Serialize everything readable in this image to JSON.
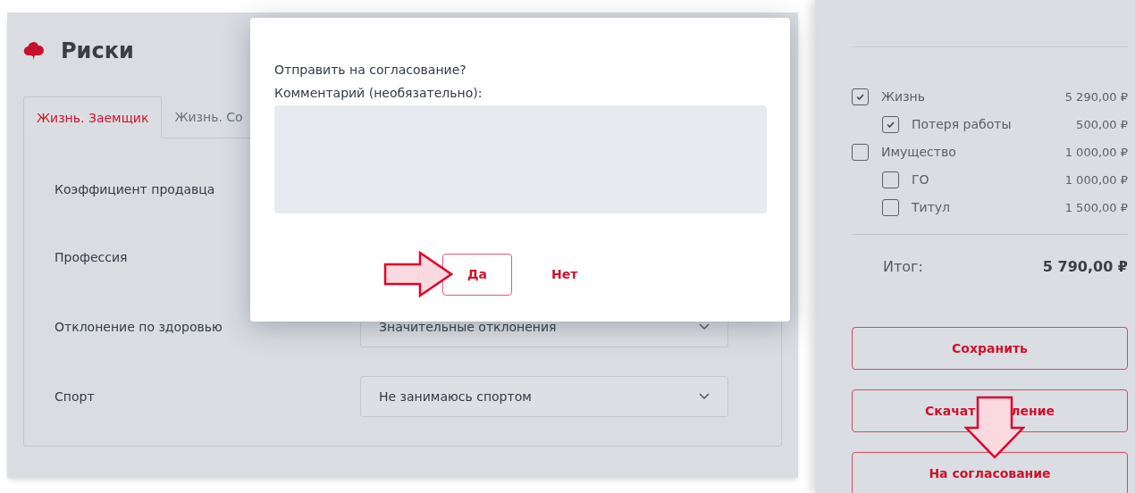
{
  "page": {
    "title": "Риски"
  },
  "tabs": [
    {
      "label": "Жизнь. Заемщик",
      "selected": true
    },
    {
      "label": "Жизнь. Со",
      "selected": false
    }
  ],
  "fields": [
    {
      "label": "Коэффициент продавца"
    },
    {
      "label": "Профессия"
    },
    {
      "label": "Отклонение по здоровью",
      "value": "Значительные отклонения"
    },
    {
      "label": "Спорт",
      "value": "Не занимаюсь спортом"
    }
  ],
  "summary": {
    "items": [
      {
        "label": "Жизнь",
        "amount": "5 290,00 ₽",
        "checked": true,
        "children": [
          {
            "label": "Потеря работы",
            "amount": "500,00 ₽",
            "checked": true
          }
        ]
      },
      {
        "label": "Имущество",
        "amount": "1 000,00 ₽",
        "checked": false,
        "children": [
          {
            "label": "ГО",
            "amount": "1 000,00 ₽",
            "checked": false
          },
          {
            "label": "Титул",
            "amount": "1 500,00 ₽",
            "checked": false
          }
        ]
      }
    ],
    "total_label": "Итог:",
    "total": "5 790,00 ₽"
  },
  "actions": [
    {
      "parts": [
        "Сохранить"
      ]
    },
    {
      "parts": [
        "Скачат",
        "ление"
      ]
    },
    {
      "parts": [
        "На согласование"
      ]
    }
  ],
  "dialog": {
    "question": "Отправить на согласование?",
    "comment_label": "Комментарий (необязательно):",
    "buttons": [
      {
        "label": "Да",
        "kind": "outlined"
      },
      {
        "label": "Нет",
        "kind": "text"
      }
    ]
  }
}
